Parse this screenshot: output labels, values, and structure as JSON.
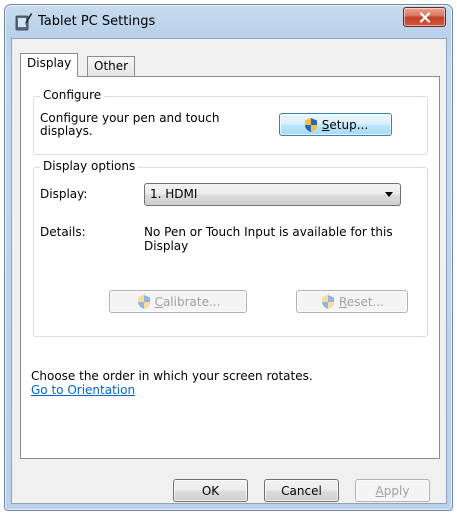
{
  "window": {
    "title": "Tablet PC Settings"
  },
  "tabs": [
    {
      "label": "Display"
    },
    {
      "label": "Other"
    }
  ],
  "configure": {
    "group_title": "Configure",
    "description_line1": "Configure your pen and touch",
    "description_line2": "displays.",
    "setup_button": {
      "mnemonic": "S",
      "rest": "etup..."
    }
  },
  "display_options": {
    "group_title": "Display options",
    "display_label": "Display:",
    "display_value": "1. HDMI",
    "details_label": "Details:",
    "details_line1": "No Pen or Touch Input is available for this",
    "details_line2": "Display",
    "calibrate_button": {
      "mnemonic": "C",
      "rest": "alibrate..."
    },
    "reset_button": {
      "mnemonic": "R",
      "rest": "eset..."
    }
  },
  "orientation": {
    "text": "Choose the order in which your screen rotates.",
    "link": "Go to Orientation"
  },
  "footer": {
    "ok": "OK",
    "cancel": "Cancel",
    "apply_mnemonic": "A",
    "apply_rest": "pply"
  },
  "colors": {
    "link": "#0066cc",
    "close_button": "#c4402a",
    "focus_border": "#3c7fb1"
  }
}
